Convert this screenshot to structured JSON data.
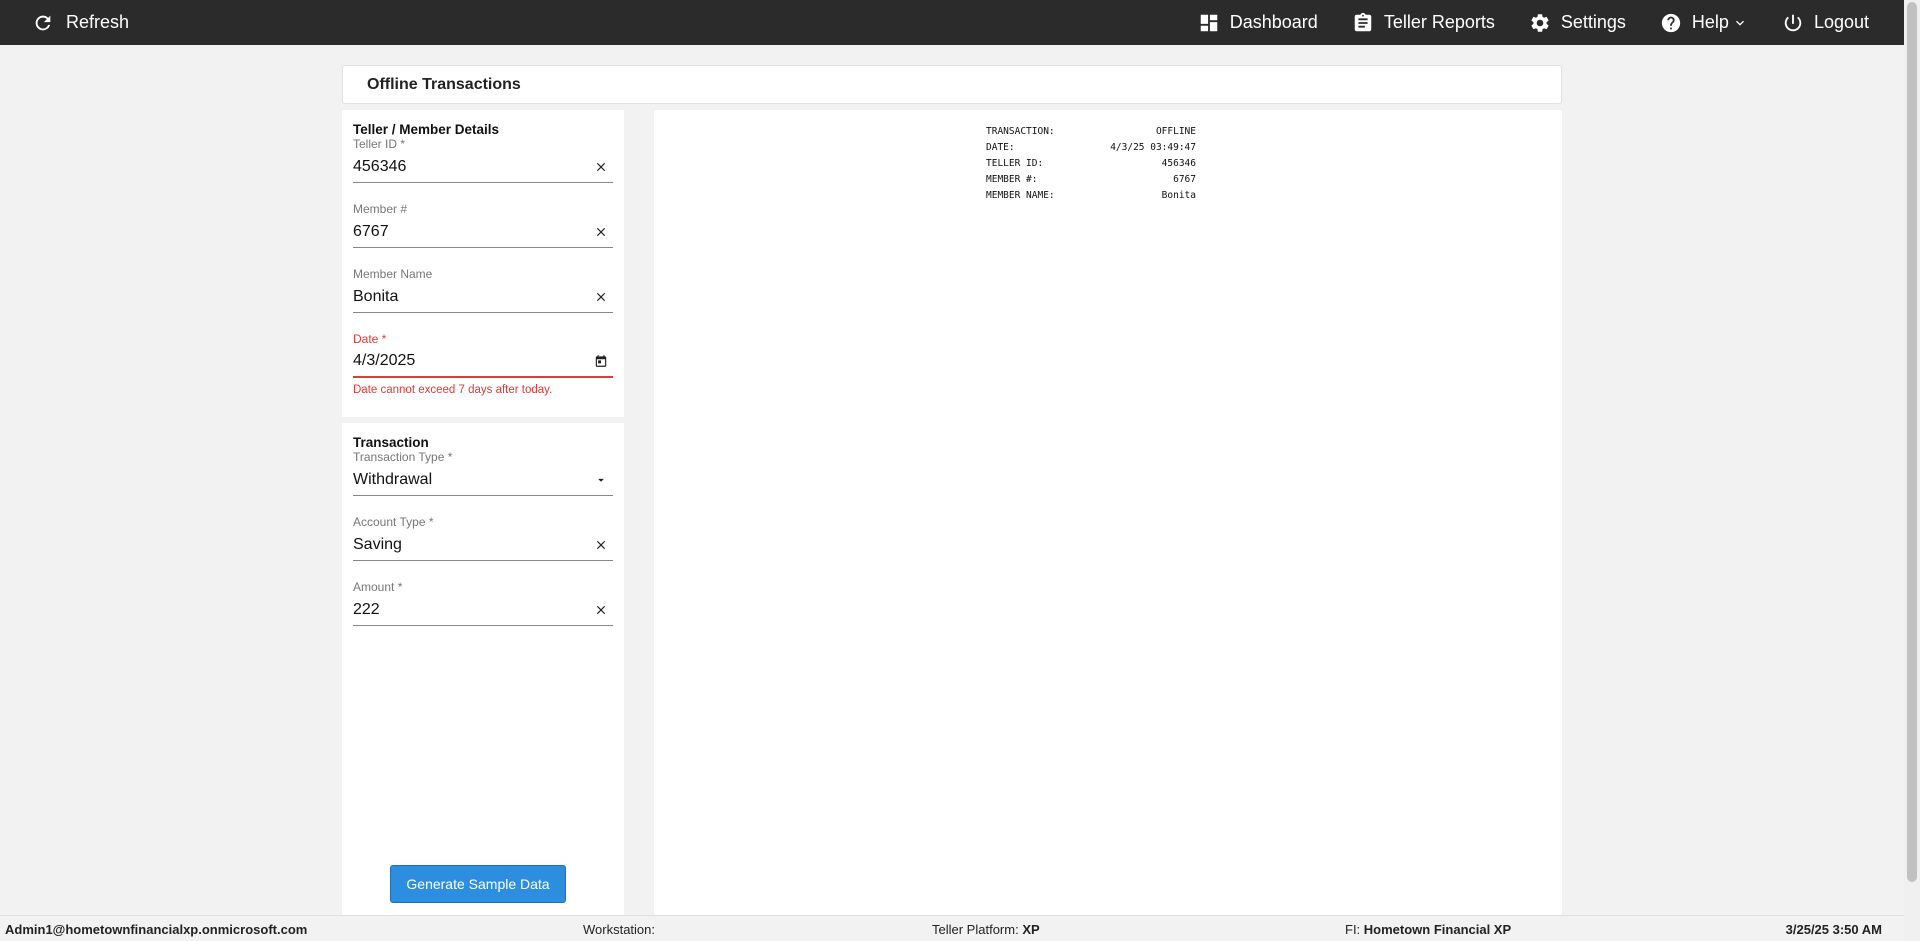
{
  "topbar": {
    "refresh": "Refresh",
    "dashboard": "Dashboard",
    "teller_reports": "Teller Reports",
    "settings": "Settings",
    "help": "Help",
    "logout": "Logout"
  },
  "header": {
    "title": "Offline Transactions"
  },
  "teller_member": {
    "title": "Teller / Member Details",
    "teller_id": {
      "label": "Teller ID *",
      "value": "456346"
    },
    "member_number": {
      "label": "Member #",
      "value": "6767"
    },
    "member_name": {
      "label": "Member Name",
      "value": "Bonita"
    },
    "date": {
      "label": "Date *",
      "value": "4/3/2025",
      "error": "Date cannot exceed 7 days after today."
    }
  },
  "transaction": {
    "title": "Transaction",
    "type": {
      "label": "Transaction Type *",
      "value": "Withdrawal"
    },
    "account_type": {
      "label": "Account Type *",
      "value": "Saving"
    },
    "amount": {
      "label": "Amount *",
      "value": "222"
    },
    "generate_button": "Generate Sample Data"
  },
  "receipt": {
    "rows": [
      {
        "label": "TRANSACTION:",
        "value": "OFFLINE"
      },
      {
        "label": "DATE:",
        "value": "4/3/25 03:49:47"
      },
      {
        "label": "TELLER ID:",
        "value": "456346"
      },
      {
        "label": "MEMBER #:",
        "value": "6767"
      },
      {
        "label": "MEMBER NAME:",
        "value": "Bonita"
      }
    ]
  },
  "statusbar": {
    "user": "Admin1@hometownfinancialxp.onmicrosoft.com",
    "workstation_label": "Workstation:",
    "workstation_value": "",
    "platform_label": "Teller Platform:",
    "platform_value": "XP",
    "fi_label": "FI:",
    "fi_value": "Hometown Financial XP",
    "datetime": "3/25/25 3:50 AM"
  },
  "colors": {
    "topbar": "#2b2b2b",
    "accent": "#2d8ee0",
    "error": "#e53935"
  }
}
